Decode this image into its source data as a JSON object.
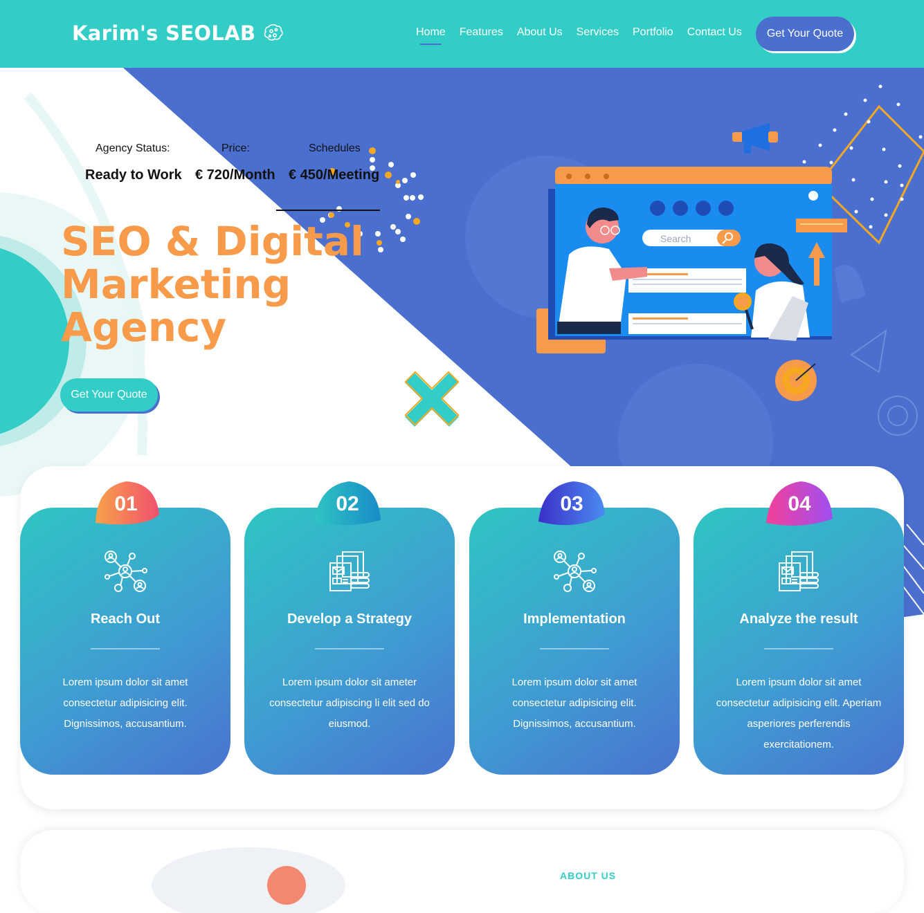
{
  "brand": {
    "name": "Karim's SEOLAB"
  },
  "nav": {
    "items": [
      "Home",
      "Features",
      "About Us",
      "Services",
      "Portfolio",
      "Contact Us"
    ],
    "active": "Home",
    "cta": "Get Your Quote"
  },
  "hero": {
    "stats": {
      "status_label": "Agency Status:",
      "price_label": "Price:",
      "schedules_label": "Schedules",
      "status_value": "Ready to Work",
      "price_value": "€ 720/Month",
      "schedules_value": "€ 450/Meeting"
    },
    "title_lines": [
      "SEO & Digital",
      "Marketing",
      "Agency"
    ],
    "cta": "Get Your Quote",
    "illustration": {
      "search_placeholder": "Search"
    }
  },
  "steps": [
    {
      "number": "01",
      "title": "Reach Out",
      "body": "Lorem ipsum dolor sit amet consectetur adipisicing elit. Dignissimos, accusantium.",
      "icon": "network-icon"
    },
    {
      "number": "02",
      "title": "Develop a Strategy",
      "body": "Lorem ipsum dolor sit ameter consectetur adipiscing li elit sed do eiusmod.",
      "icon": "documents-icon"
    },
    {
      "number": "03",
      "title": "Implementation",
      "body": "Lorem ipsum dolor sit amet consectetur adipisicing elit. Dignissimos, accusantium.",
      "icon": "network-icon"
    },
    {
      "number": "04",
      "title": "Analyze the result",
      "body": "Lorem ipsum dolor sit amet consectetur adipisicing elit. Aperiam asperiores perferendis exercitationem.",
      "icon": "documents-icon"
    }
  ],
  "about": {
    "label": "ABOUT US"
  },
  "colors": {
    "teal": "#33cdc7",
    "blue": "#4b6fcf",
    "orange": "#f79a4a"
  }
}
